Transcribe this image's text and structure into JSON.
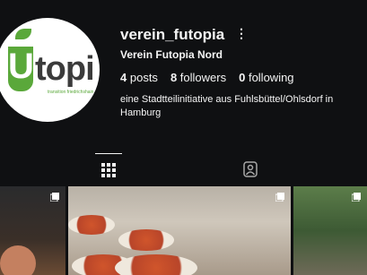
{
  "profile": {
    "username": "verein_futopia",
    "full_name": "Verein Futopia Nord",
    "bio": "eine Stadtteilinitiative aus Fuhlsbüttel/Ohlsdorf in Hamburg",
    "avatar_text": {
      "u": "U",
      "rest": "topi",
      "tagline": "transition friedrichshain"
    }
  },
  "stats": {
    "posts_count": "4",
    "posts_label": "posts",
    "followers_count": "8",
    "followers_label": "followers",
    "following_count": "0",
    "following_label": "following"
  },
  "tabs": {
    "active": "grid",
    "icons": [
      "grid-icon",
      "tagged-icon"
    ]
  },
  "grid": {
    "posts": [
      {
        "multi": true
      },
      {
        "multi": true
      },
      {
        "multi": true
      }
    ]
  }
}
